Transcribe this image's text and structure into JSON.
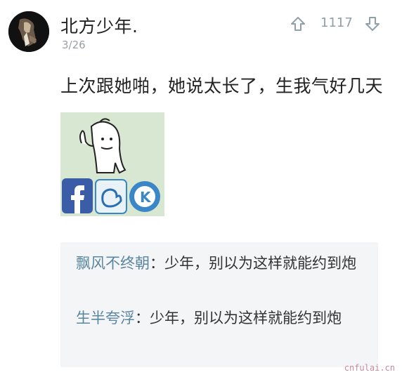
{
  "post": {
    "username": "北方少年.",
    "date": "3/26",
    "vote_count": "1117",
    "text": "上次跟她啪，她说太长了，生我气好几天"
  },
  "comments": [
    {
      "author": "飘风不终朝",
      "separator": "：",
      "text": "少年，别以为这样就能约到炮"
    },
    {
      "author": "生半夸浮",
      "separator": "：",
      "text": "少年，别以为这样就能约到炮"
    }
  ],
  "watermark": "cnfulai.cn",
  "colors": {
    "author": "#5a86a0",
    "vote": "#8fa0aa",
    "comment_bg": "#f4f5f7",
    "meme_bg": "#d7e7d2"
  }
}
